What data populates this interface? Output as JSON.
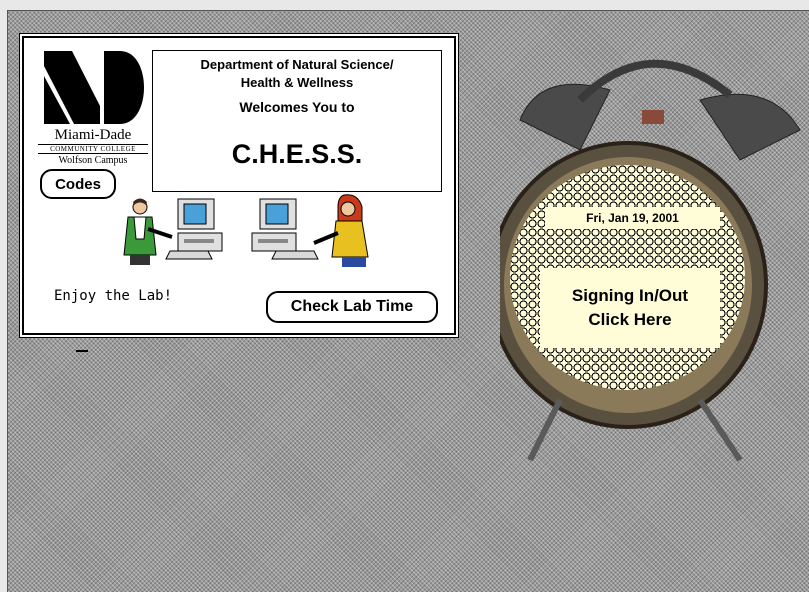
{
  "header": {
    "department_line1": "Department of Natural Science/",
    "department_line2": "Health & Wellness",
    "welcome": "Welcomes You to",
    "program": "C.H.E.S.S."
  },
  "logo": {
    "name": "Miami-Dade",
    "college": "COMMUNITY COLLEGE",
    "campus": "Wolfson Campus"
  },
  "buttons": {
    "codes": "Codes",
    "check_lab_time": "Check Lab Time"
  },
  "footer_text": "Enjoy the Lab!",
  "clock": {
    "date": "Fri, Jan 19, 2001",
    "sign_line1": "Signing In/Out",
    "sign_line2": "Click Here"
  },
  "colors": {
    "face": "#fffcd8",
    "background": "#9a9a9a"
  }
}
